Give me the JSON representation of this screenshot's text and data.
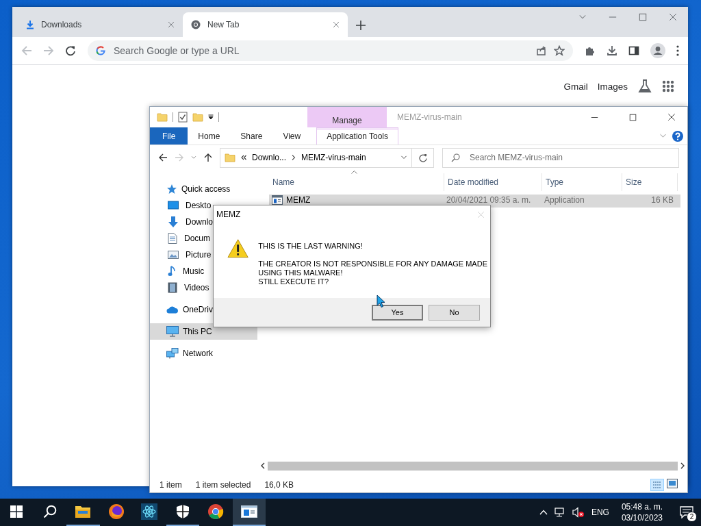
{
  "browser": {
    "tabs": [
      {
        "label": "Downloads",
        "kind": "download",
        "selected": false
      },
      {
        "label": "New Tab",
        "kind": "chrome",
        "selected": true
      }
    ],
    "address_placeholder": "Search Google or type a URL",
    "header_links": [
      "Gmail",
      "Images"
    ]
  },
  "explorer": {
    "title": "MEMZ-virus-main",
    "context_header": "Manage",
    "ribbon_tabs": [
      {
        "label": "File",
        "kind": "file"
      },
      {
        "label": "Home",
        "kind": "plain"
      },
      {
        "label": "Share",
        "kind": "plain"
      },
      {
        "label": "View",
        "kind": "plain"
      },
      {
        "label": "Application Tools",
        "kind": "contextual"
      }
    ],
    "path": [
      "Downlo...",
      "MEMZ-virus-main"
    ],
    "search_placeholder": "Search MEMZ-virus-main",
    "nav": [
      {
        "label": "Quick access",
        "kind": "star",
        "selected": false,
        "children": [
          {
            "label": "Deskto",
            "kind": "desktop",
            "selected": false
          },
          {
            "label": "Downlo",
            "kind": "downloads",
            "selected": false
          },
          {
            "label": "Docum",
            "kind": "documents",
            "selected": false
          },
          {
            "label": "Picture",
            "kind": "pictures",
            "selected": false
          },
          {
            "label": "Music",
            "kind": "music",
            "selected": false
          },
          {
            "label": "Videos",
            "kind": "videos",
            "selected": false
          }
        ]
      },
      {
        "label": "OneDriv",
        "kind": "cloud",
        "selected": false
      },
      {
        "label": "This PC",
        "kind": "pc",
        "selected": true
      },
      {
        "label": "Network",
        "kind": "network",
        "selected": false
      }
    ],
    "columns": [
      "Name",
      "Date modified",
      "Type",
      "Size"
    ],
    "files": [
      {
        "name": "MEMZ",
        "date_modified": "20/04/2021 09:35 a. m.",
        "type": "Application",
        "size": "16 KB",
        "selected": true
      }
    ],
    "status": [
      "1 item",
      "1 item selected",
      "16,0 KB"
    ]
  },
  "dialog": {
    "title": "MEMZ",
    "message": [
      "THIS IS THE LAST WARNING!",
      "THE CREATOR IS NOT RESPONSIBLE FOR ANY DAMAGE MADE\nUSING THIS MALWARE!\nSTILL EXECUTE IT?"
    ],
    "buttons": [
      {
        "label": "Yes",
        "default": true
      },
      {
        "label": "No",
        "default": false
      }
    ]
  },
  "taskbar": {
    "apps": [
      {
        "kind": "explorer",
        "running": true,
        "active": false
      },
      {
        "kind": "firefox",
        "running": false,
        "active": false
      },
      {
        "kind": "atom",
        "running": false,
        "active": false
      },
      {
        "kind": "shield",
        "running": true,
        "active": false
      },
      {
        "kind": "chrome",
        "running": false,
        "active": false
      },
      {
        "kind": "window",
        "running": true,
        "active": true
      }
    ],
    "language": "ENG",
    "time": "05:48 a. m.",
    "date": "03/10/2023",
    "notification_count": "2"
  }
}
